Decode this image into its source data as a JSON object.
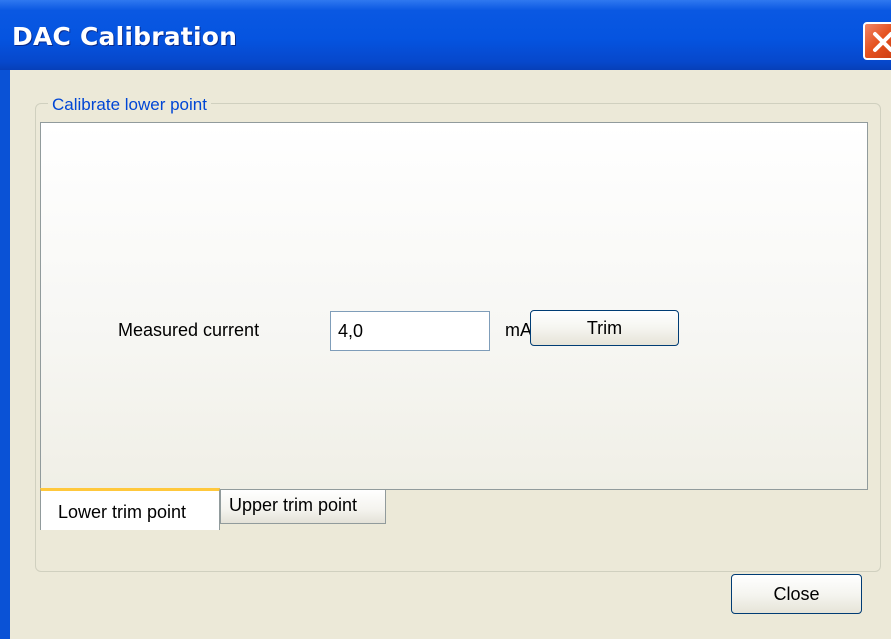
{
  "window": {
    "title": "DAC Calibration",
    "close_icon": "close-icon"
  },
  "group": {
    "legend": "Calibrate lower point"
  },
  "form": {
    "measured_label": "Measured current",
    "measured_value": "4,0",
    "unit": "mA",
    "trim_button": "Trim"
  },
  "tabs": [
    {
      "label": "Lower trim point",
      "selected": true
    },
    {
      "label": "Upper trim point",
      "selected": false
    }
  ],
  "footer": {
    "close_button": "Close"
  },
  "colors": {
    "titlebar": "#0554e0",
    "client_bg": "#ece9d8",
    "legend_text": "#0046d5",
    "active_tab_accent": "#ffc83c",
    "close_button_red": "#e5521f"
  }
}
